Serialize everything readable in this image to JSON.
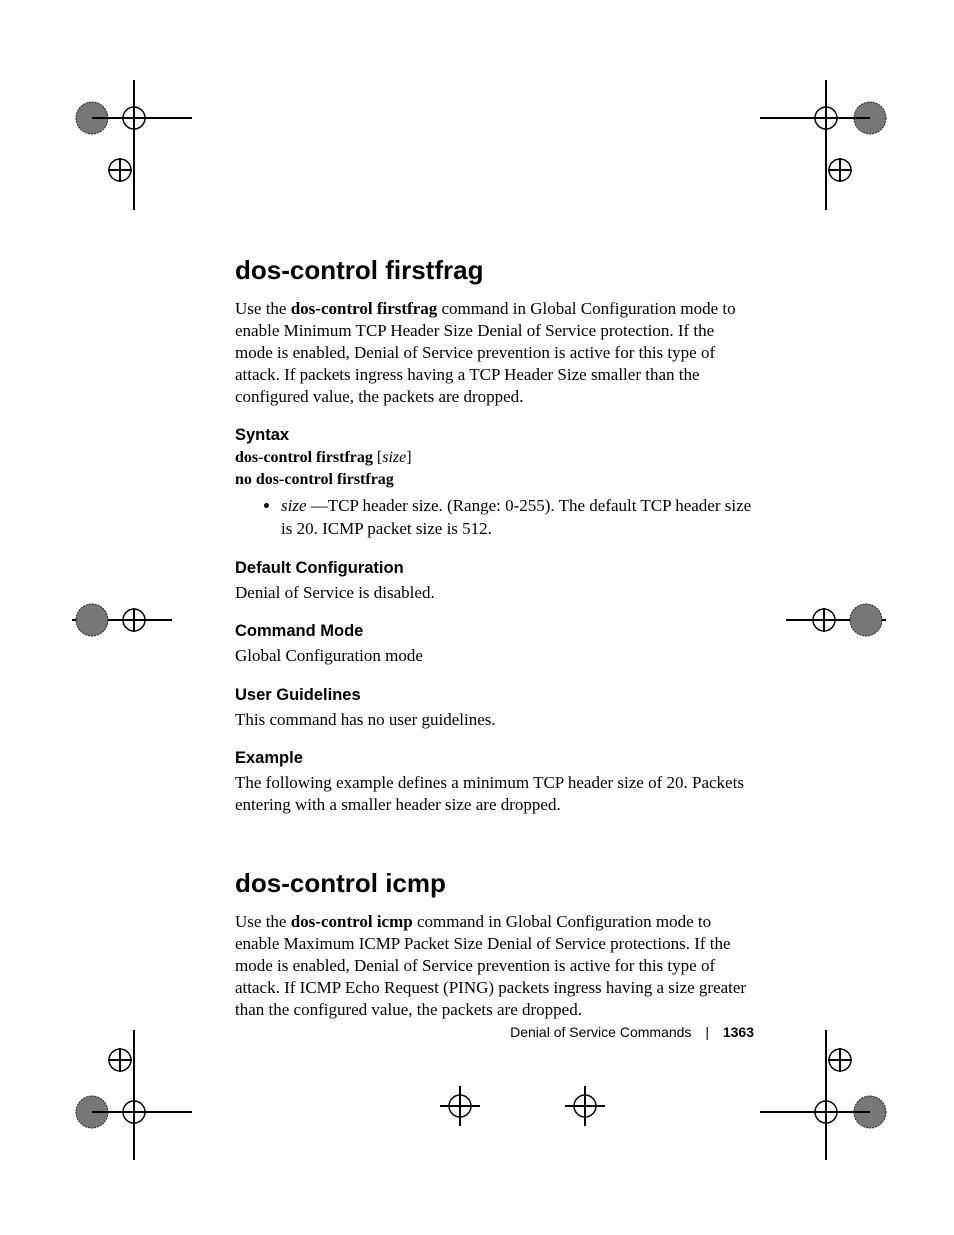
{
  "sections": [
    {
      "title": "dos-control firstfrag",
      "intro_pre": "Use the ",
      "intro_cmd": "dos-control firstfrag",
      "intro_post": " command in Global Configuration mode to enable Minimum TCP Header Size Denial of Service protection. If the mode is enabled, Denial of Service prevention is active for this type of attack. If packets ingress having a TCP Header Size smaller than the configured value, the packets are dropped.",
      "syntax_heading": "Syntax",
      "syntax_cmd": "dos-control firstfrag",
      "syntax_param": "size",
      "syntax_no": "no dos-control firstfrag",
      "bullet_param": "size",
      "bullet_text": " —TCP header size. (Range: 0-255). The default TCP header size is 20. ICMP packet size is 512.",
      "default_heading": "Default Configuration",
      "default_text": "Denial of Service is disabled.",
      "mode_heading": "Command Mode",
      "mode_text": "Global Configuration mode",
      "guidelines_heading": "User Guidelines",
      "guidelines_text": "This command has no user guidelines.",
      "example_heading": "Example",
      "example_text": "The following example defines a minimum TCP header size of 20. Packets entering with a smaller header size are dropped."
    },
    {
      "title": "dos-control icmp",
      "intro_pre": "Use the ",
      "intro_cmd": "dos-control icmp",
      "intro_post": " command in Global Configuration mode to enable Maximum ICMP Packet Size Denial of Service protections. If the mode is enabled, Denial of Service prevention is active for this type of attack. If ICMP Echo Request (PING) packets ingress having a size greater than the configured value, the packets are dropped."
    }
  ],
  "footer": {
    "section": "Denial of Service Commands",
    "page": "1363"
  }
}
